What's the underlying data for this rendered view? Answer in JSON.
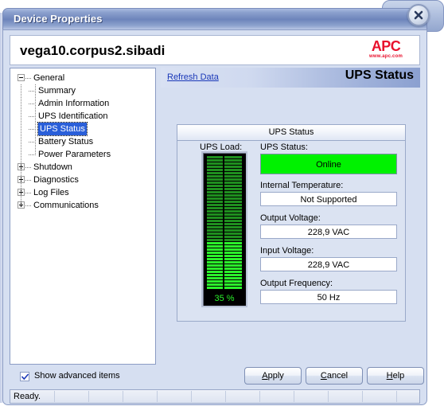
{
  "window": {
    "title": "Device Properties",
    "close_icon": "close-icon"
  },
  "header": {
    "hostname": "vega10.corpus2.sibadi",
    "logo_word": "APC",
    "logo_url": "www.apc.com"
  },
  "tree": {
    "nodes": [
      {
        "label": "General",
        "toggle": "minus",
        "depth": 0,
        "selected": false
      },
      {
        "label": "Summary",
        "toggle": "none",
        "depth": 1,
        "selected": false
      },
      {
        "label": "Admin Information",
        "toggle": "none",
        "depth": 1,
        "selected": false
      },
      {
        "label": "UPS Identification",
        "toggle": "none",
        "depth": 1,
        "selected": false
      },
      {
        "label": "UPS Status",
        "toggle": "none",
        "depth": 1,
        "selected": true
      },
      {
        "label": "Battery Status",
        "toggle": "none",
        "depth": 1,
        "selected": false
      },
      {
        "label": "Power Parameters",
        "toggle": "none",
        "depth": 1,
        "selected": false
      },
      {
        "label": "Shutdown",
        "toggle": "plus",
        "depth": 0,
        "selected": false
      },
      {
        "label": "Diagnostics",
        "toggle": "plus",
        "depth": 0,
        "selected": false
      },
      {
        "label": "Log Files",
        "toggle": "plus",
        "depth": 0,
        "selected": false
      },
      {
        "label": "Communications",
        "toggle": "plus",
        "depth": 0,
        "selected": false
      }
    ]
  },
  "pane": {
    "refresh_label": "Refresh Data",
    "title": "UPS Status"
  },
  "group": {
    "title": "UPS Status",
    "load_label": "UPS Load:",
    "load_percent": 35,
    "load_value_text": "35 %",
    "fields": [
      {
        "label": "UPS Status:",
        "value": "Online",
        "highlight": true
      },
      {
        "label": "Internal Temperature:",
        "value": "Not Supported",
        "highlight": false
      },
      {
        "label": "Output Voltage:",
        "value": "228,9 VAC",
        "highlight": false
      },
      {
        "label": "Input Voltage:",
        "value": "228,9 VAC",
        "highlight": false
      },
      {
        "label": "Output Frequency:",
        "value": "50 Hz",
        "highlight": false
      }
    ]
  },
  "footer": {
    "checkbox_label": "Show advanced items",
    "checkbox_checked": true,
    "buttons": [
      {
        "label": "Apply",
        "mnemonic": "A"
      },
      {
        "label": "Cancel",
        "mnemonic": "C"
      },
      {
        "label": "Help",
        "mnemonic": "H"
      }
    ],
    "status_text": "Ready."
  },
  "colors": {
    "title_bar_blue": "#6d84bb",
    "selection_blue": "#2a5fd9",
    "status_green": "#00f200",
    "gauge_bright_green": "#2bf22b",
    "gauge_dark_green": "#1f8f1f",
    "link_blue": "#1a38b8",
    "apc_red": "#e8112d"
  }
}
